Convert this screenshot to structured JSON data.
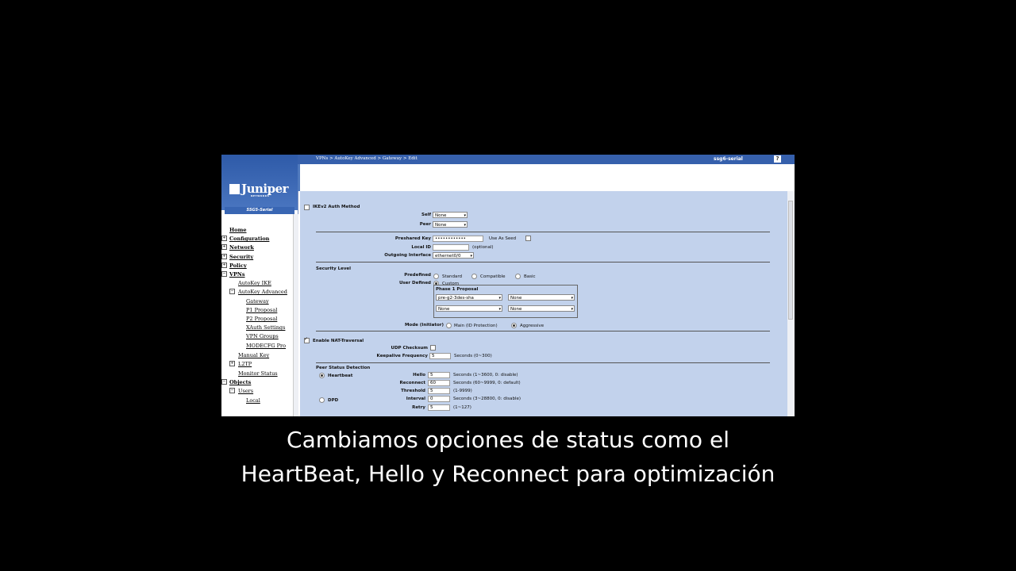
{
  "header": {
    "breadcrumb": "VPNs > AutoKey Advanced > Gateway > Edit",
    "device_name": "ssg6-serial",
    "help": "?"
  },
  "sidebar": {
    "logo_text": "Juniper",
    "logo_sub": "NETWORKS",
    "device_label": "SSG5-Serial",
    "items": [
      {
        "label": "Home"
      },
      {
        "label": "Configuration"
      },
      {
        "label": "Network"
      },
      {
        "label": "Security"
      },
      {
        "label": "Policy"
      },
      {
        "label": "VPNs"
      },
      {
        "label": "AutoKey IKE"
      },
      {
        "label": "AutoKey Advanced"
      },
      {
        "label": "Gateway"
      },
      {
        "label": "P1 Proposal"
      },
      {
        "label": "P2 Proposal"
      },
      {
        "label": "XAuth Settings"
      },
      {
        "label": "VPN Groups"
      },
      {
        "label": "MODECFG Pro"
      },
      {
        "label": "Manual Key"
      },
      {
        "label": "L2TP"
      },
      {
        "label": "Monitor Status"
      },
      {
        "label": "Objects"
      },
      {
        "label": "Users"
      },
      {
        "label": "Local"
      }
    ]
  },
  "form": {
    "ikev2_label": "IKEv2 Auth Method",
    "self_label": "Self",
    "self_value": "None",
    "peer_label": "Peer",
    "peer_value": "None",
    "preshared_label": "Preshared Key",
    "preshared_value": "••••••••••••",
    "use_as_seed_label": "Use As Seed",
    "local_id_label": "Local ID",
    "local_id_value": "",
    "optional_label": "(optional)",
    "outgoing_label": "Outgoing Interface",
    "outgoing_value": "ethernet0/0",
    "security_level_label": "Security Level",
    "predefined_label": "Predefined",
    "standard_label": "Standard",
    "compatible_label": "Compatible",
    "basic_label": "Basic",
    "user_defined_label": "User Defined",
    "custom_label": "Custom",
    "phase1_label": "Phase 1 Proposal",
    "phase1_values": [
      "pre-g2-3des-sha",
      "None",
      "None",
      "None"
    ],
    "mode_label": "Mode (Initiator)",
    "main_label": "Main (ID Protection)",
    "aggressive_label": "Aggressive",
    "nat_label": "Enable NAT-Traversal",
    "udp_label": "UDP Checksum",
    "keepalive_label": "Keepalive Frequency",
    "keepalive_value": "5",
    "keepalive_hint": "Seconds (0~300)",
    "psd_label": "Peer Status Detection",
    "heartbeat_label": "Heartbeat",
    "hello_label": "Hello",
    "hello_value": "5",
    "hello_hint": "Seconds (1~3600, 0: disable)",
    "reconnect_label": "Reconnect",
    "reconnect_value": "60",
    "reconnect_hint": "Seconds (60~9999, 0: default)",
    "threshold_label": "Threshold",
    "threshold_value": "5",
    "threshold_hint": "(1-9999)",
    "dpd_label": "DPD",
    "interval_label": "Interval",
    "interval_value": "0",
    "interval_hint": "Seconds (3~28800, 0: disable)",
    "retry_label": "Retry",
    "retry_value": "5",
    "retry_hint": "(1~127)"
  },
  "caption": {
    "line1": "Cambiamos opciones de status como el",
    "line2": "HeartBeat, Hello y Reconnect para optimización"
  }
}
